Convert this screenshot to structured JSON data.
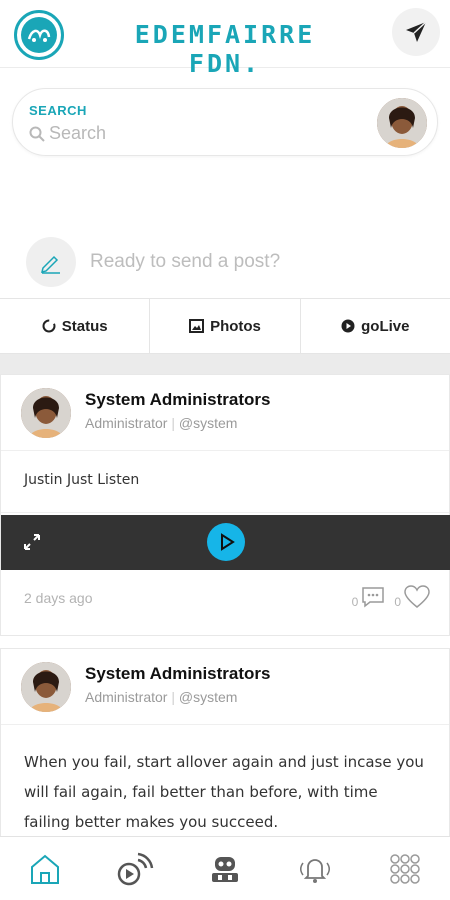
{
  "header": {
    "brand": "EDEMFAIRRE FDN.",
    "icons": {
      "logo": "brand-logo",
      "send": "paper-plane-icon"
    }
  },
  "search": {
    "label": "SEARCH",
    "placeholder": "Search",
    "icon": "search-icon"
  },
  "composer": {
    "prompt": "Ready to send a post?",
    "icon": "pencil-icon"
  },
  "tabs": [
    {
      "label": "Status",
      "icon": "circle-loader-icon"
    },
    {
      "label": "Photos",
      "icon": "image-icon"
    },
    {
      "label": "goLive",
      "icon": "play-circle-icon"
    }
  ],
  "posts": [
    {
      "author": "System Administrators",
      "role": "Administrator",
      "handle": "@system",
      "text": "Justin Just Listen",
      "timestamp": "2 days ago",
      "comments": "0",
      "likes": "0"
    },
    {
      "author": "System Administrators",
      "role": "Administrator",
      "handle": "@system",
      "text": "When you fail, start allover again and just incase you will fail again, fail better than before, with time failing better makes you succeed."
    }
  ],
  "bottom_nav": [
    {
      "name": "home-icon",
      "active": true
    },
    {
      "name": "broadcast-icon",
      "active": false
    },
    {
      "name": "robot-icon",
      "active": false
    },
    {
      "name": "notification-bell-icon",
      "active": false
    },
    {
      "name": "apps-grid-icon",
      "active": false
    }
  ],
  "colors": {
    "accent": "#1aa6b7",
    "play_button": "#16b5e8",
    "video_bar": "#333333",
    "muted_text": "#9a9a9a"
  }
}
